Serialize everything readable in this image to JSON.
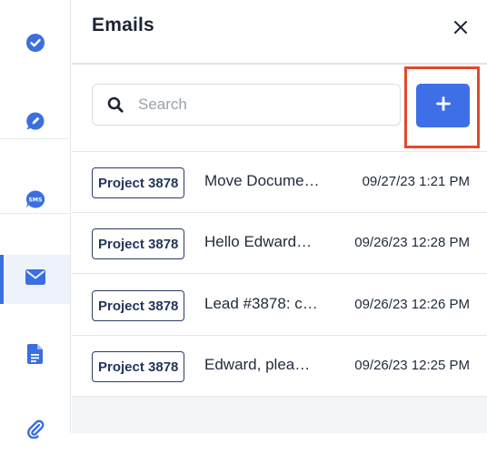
{
  "panel": {
    "title": "Emails"
  },
  "search": {
    "placeholder": "Search"
  },
  "colors": {
    "accent": "#3e6fe6",
    "highlight_box": "#e14a2c",
    "tag_border": "#2a3d63"
  },
  "rail": {
    "items": [
      {
        "icon": "check-circle-icon"
      },
      {
        "icon": "edit-pencil-icon"
      },
      {
        "icon": "sms-chat-icon"
      },
      {
        "icon": "email-envelope-icon",
        "active": true
      },
      {
        "icon": "document-icon"
      },
      {
        "icon": "paperclip-icon"
      }
    ]
  },
  "emails": [
    {
      "project": "Project 3878",
      "subject": "Move Docume…",
      "time": "09/27/23 1:21 PM"
    },
    {
      "project": "Project 3878",
      "subject": "Hello Edward…",
      "time": "09/26/23 12:28 PM"
    },
    {
      "project": "Project 3878",
      "subject": "Lead #3878: c…",
      "time": "09/26/23 12:26 PM"
    },
    {
      "project": "Project 3878",
      "subject": "Edward, plea…",
      "time": "09/26/23 12:25 PM"
    }
  ]
}
